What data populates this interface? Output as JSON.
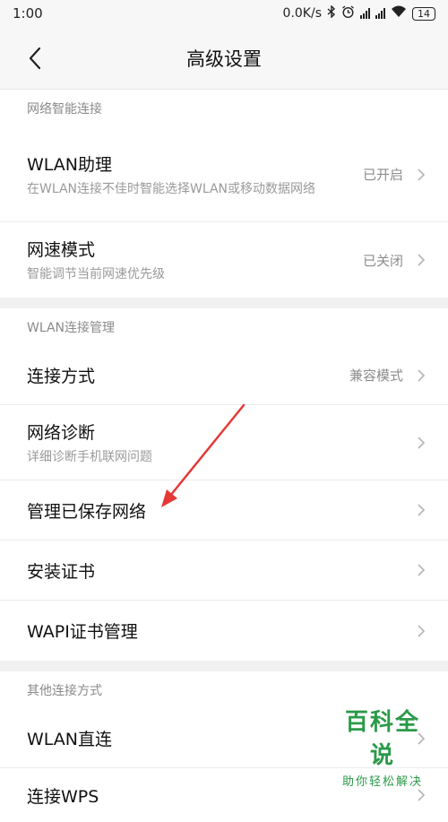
{
  "status": {
    "time": "1:00",
    "net_speed": "0.0K/s",
    "battery": "14"
  },
  "header": {
    "title": "高级设置"
  },
  "sections": [
    {
      "label": "网络智能连接",
      "items": [
        {
          "title": "WLAN助理",
          "subtitle": "在WLAN连接不佳时智能选择WLAN或移动数据网络",
          "value": "已开启"
        },
        {
          "title": "网速模式",
          "subtitle": "智能调节当前网速优先级",
          "value": "已关闭"
        }
      ]
    },
    {
      "label": "WLAN连接管理",
      "items": [
        {
          "title": "连接方式",
          "value": "兼容模式"
        },
        {
          "title": "网络诊断",
          "subtitle": "详细诊断手机联网问题"
        },
        {
          "title": "管理已保存网络"
        },
        {
          "title": "安装证书"
        },
        {
          "title": "WAPI证书管理"
        }
      ]
    },
    {
      "label": "其他连接方式",
      "items": [
        {
          "title": "WLAN直连"
        },
        {
          "title": "连接WPS"
        }
      ]
    }
  ],
  "watermark": {
    "title": "百科全说",
    "subtitle": "助你轻松解决"
  },
  "annotation": {
    "color": "#e53935"
  }
}
